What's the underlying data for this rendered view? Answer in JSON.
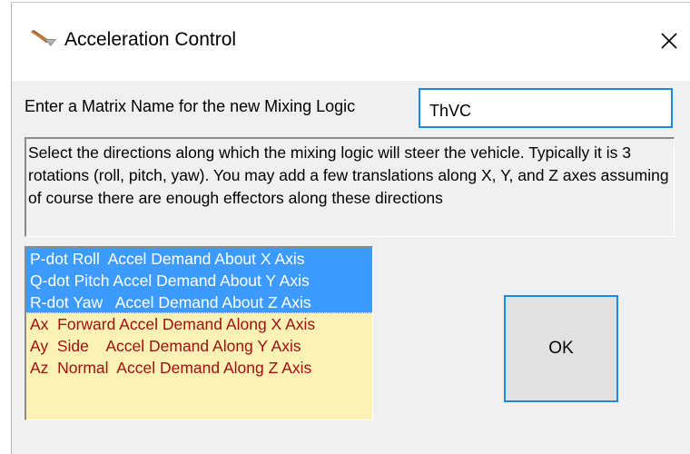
{
  "window": {
    "title": "Acceleration Control",
    "icon": "arrow-app-icon",
    "close_icon": "close-icon"
  },
  "prompt": {
    "label": "Enter a Matrix Name for the new Mixing Logic",
    "input_value": "ThVC"
  },
  "instructions": {
    "text": "Select the directions along which the mixing logic will steer the vehicle. Typically it is 3 rotations (roll, pitch,  yaw). You may add a few translations along X, Y, and Z axes assuming of course there are enough effectors along these directions"
  },
  "directions_list": {
    "items": [
      {
        "label": "P-dot Roll  Accel Demand About X Axis",
        "selected": true
      },
      {
        "label": "Q-dot Pitch Accel Demand About Y Axis",
        "selected": true
      },
      {
        "label": "R-dot Yaw   Accel Demand About Z Axis",
        "selected": true
      },
      {
        "label": "Ax  Forward Accel Demand Along X Axis",
        "selected": false
      },
      {
        "label": "Ay  Side    Accel Demand Along Y Axis",
        "selected": false
      },
      {
        "label": "Az  Normal  Accel Demand Along Z Axis",
        "selected": false
      }
    ]
  },
  "ok_button": {
    "label": "OK"
  },
  "colors": {
    "selection_blue": "#3d9bff",
    "list_background": "#fdf2b5",
    "unselected_text": "#a01010",
    "focus_border": "#1e88e5"
  }
}
